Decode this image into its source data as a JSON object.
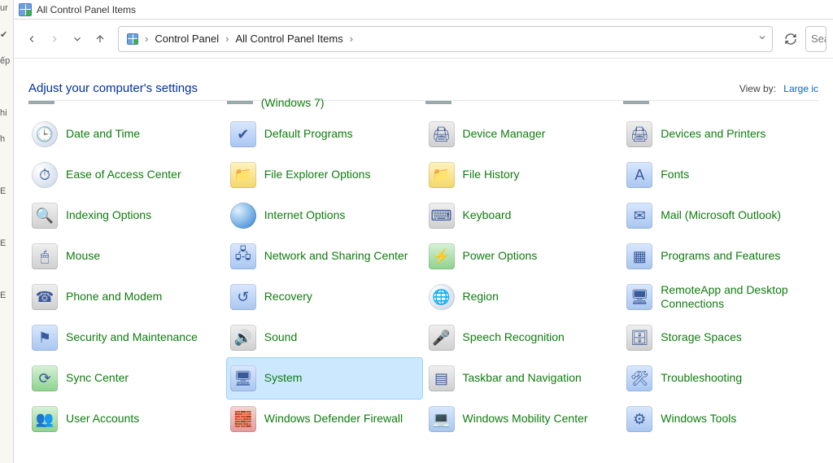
{
  "window": {
    "title": "All Control Panel Items"
  },
  "nav": {
    "breadcrumbs": [
      "Control Panel",
      "All Control Panel Items"
    ],
    "search_placeholder": "Sea"
  },
  "header": {
    "title": "Adjust your computer's settings",
    "viewby_label": "View by:",
    "viewby_value": "Large ic"
  },
  "cut_row": {
    "col1": "",
    "col2": "(Windows 7)",
    "col3": "",
    "col4": ""
  },
  "items": [
    {
      "label": "Date and Time",
      "icon": "clock",
      "glyph": "🕒",
      "selected": false,
      "name": "date-and-time"
    },
    {
      "label": "Default Programs",
      "icon": "blue",
      "glyph": "✔",
      "selected": false,
      "name": "default-programs"
    },
    {
      "label": "Device Manager",
      "icon": "gray",
      "glyph": "🖨",
      "selected": false,
      "name": "device-manager"
    },
    {
      "label": "Devices and Printers",
      "icon": "gray",
      "glyph": "🖨",
      "selected": false,
      "name": "devices-and-printers"
    },
    {
      "label": "Ease of Access Center",
      "icon": "clock",
      "glyph": "⏱",
      "selected": false,
      "name": "ease-of-access-center"
    },
    {
      "label": "File Explorer Options",
      "icon": "yellow",
      "glyph": "📁",
      "selected": false,
      "name": "file-explorer-options"
    },
    {
      "label": "File History",
      "icon": "yellow",
      "glyph": "📁",
      "selected": false,
      "name": "file-history"
    },
    {
      "label": "Fonts",
      "icon": "blue",
      "glyph": "A",
      "selected": false,
      "name": "fonts"
    },
    {
      "label": "Indexing Options",
      "icon": "gray",
      "glyph": "🔍",
      "selected": false,
      "name": "indexing-options"
    },
    {
      "label": "Internet Options",
      "icon": "globe",
      "glyph": "",
      "selected": false,
      "name": "internet-options"
    },
    {
      "label": "Keyboard",
      "icon": "gray",
      "glyph": "⌨",
      "selected": false,
      "name": "keyboard"
    },
    {
      "label": "Mail (Microsoft Outlook)",
      "icon": "blue",
      "glyph": "✉",
      "selected": false,
      "name": "mail-outlook"
    },
    {
      "label": "Mouse",
      "icon": "gray",
      "glyph": "🖱",
      "selected": false,
      "name": "mouse"
    },
    {
      "label": "Network and Sharing Center",
      "icon": "blue",
      "glyph": "🖧",
      "selected": false,
      "name": "network-sharing-center"
    },
    {
      "label": "Power Options",
      "icon": "green",
      "glyph": "⚡",
      "selected": false,
      "name": "power-options"
    },
    {
      "label": "Programs and Features",
      "icon": "blue",
      "glyph": "▦",
      "selected": false,
      "name": "programs-and-features"
    },
    {
      "label": "Phone and Modem",
      "icon": "gray",
      "glyph": "☎",
      "selected": false,
      "name": "phone-and-modem"
    },
    {
      "label": "Recovery",
      "icon": "blue",
      "glyph": "↺",
      "selected": false,
      "name": "recovery"
    },
    {
      "label": "Region",
      "icon": "clock",
      "glyph": "🌐",
      "selected": false,
      "name": "region"
    },
    {
      "label": "RemoteApp and Desktop Connections",
      "icon": "blue",
      "glyph": "🖥",
      "selected": false,
      "name": "remoteapp-desktop-connections"
    },
    {
      "label": "Security and Maintenance",
      "icon": "blue",
      "glyph": "⚑",
      "selected": false,
      "name": "security-and-maintenance"
    },
    {
      "label": "Sound",
      "icon": "gray",
      "glyph": "🔊",
      "selected": false,
      "name": "sound"
    },
    {
      "label": "Speech Recognition",
      "icon": "gray",
      "glyph": "🎤",
      "selected": false,
      "name": "speech-recognition"
    },
    {
      "label": "Storage Spaces",
      "icon": "gray",
      "glyph": "🗄",
      "selected": false,
      "name": "storage-spaces"
    },
    {
      "label": "Sync Center",
      "icon": "green",
      "glyph": "⟳",
      "selected": false,
      "name": "sync-center"
    },
    {
      "label": "System",
      "icon": "blue",
      "glyph": "🖥",
      "selected": true,
      "name": "system"
    },
    {
      "label": "Taskbar and Navigation",
      "icon": "gray",
      "glyph": "▤",
      "selected": false,
      "name": "taskbar-and-navigation"
    },
    {
      "label": "Troubleshooting",
      "icon": "blue",
      "glyph": "🛠",
      "selected": false,
      "name": "troubleshooting"
    },
    {
      "label": "User Accounts",
      "icon": "green",
      "glyph": "👥",
      "selected": false,
      "name": "user-accounts"
    },
    {
      "label": "Windows Defender Firewall",
      "icon": "red",
      "glyph": "🧱",
      "selected": false,
      "name": "windows-defender-firewall"
    },
    {
      "label": "Windows Mobility Center",
      "icon": "blue",
      "glyph": "💻",
      "selected": false,
      "name": "windows-mobility-center"
    },
    {
      "label": "Windows Tools",
      "icon": "blue",
      "glyph": "⚙",
      "selected": false,
      "name": "windows-tools"
    }
  ],
  "left_strip": [
    "ur",
    " ",
    "ếp",
    " ",
    "hi",
    "h",
    " ",
    "E",
    " ",
    "E",
    " ",
    "E"
  ]
}
